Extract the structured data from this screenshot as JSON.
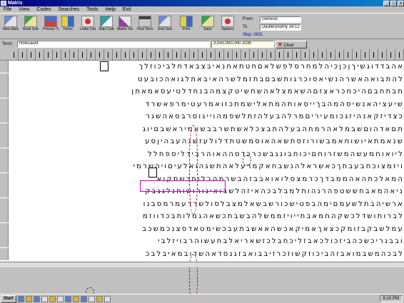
{
  "window": {
    "title": "Matrix"
  },
  "menu": [
    "File",
    "View",
    "Codes",
    "Searches",
    "Tools",
    "Help",
    "Exit"
  ],
  "toolbar": {
    "buttons": [
      {
        "label": "New Matrix",
        "icon": "new-matrix-icon"
      },
      {
        "label": "Book Select",
        "icon": "book-icon"
      },
      {
        "label": "Primary Term",
        "icon": "term-icon"
      },
      {
        "label": "Terms",
        "icon": "terms-icon"
      },
      {
        "label": "Letter Data",
        "icon": "data-icon"
      },
      {
        "label": "Skip Code",
        "icon": "skip-icon"
      },
      {
        "label": "Matrix View",
        "icon": "view-icon"
      },
      {
        "label": "Find Terms",
        "icon": "find-icon"
      },
      {
        "label": "Grid Size",
        "icon": "grid-icon"
      },
      {
        "label": "Print",
        "icon": "print-icon"
      },
      {
        "label": "Save",
        "icon": "save-icon"
      },
      {
        "label": "Options",
        "icon": "options-icon"
      }
    ],
    "fields": {
      "from_label": "From",
      "from_value": "Genesis",
      "to_label": "To",
      "to_value": "Deuteronomy 34:12"
    },
    "status": "Skip: 2631"
  },
  "search": {
    "label": "Term:",
    "value": "Holocaust",
    "readout": "3,050,000,000 2030",
    "clear_label": "Clear"
  },
  "matrix_rows": [
    "אהבדדוגשיךןכןכיהלמחרסלפשלאםחטתאחנאיבצבאדחלביכוזלך",
    "להתבואהאשרהנשיאסוכרגותשבםבתזמלשרהאיבאתלגואהכובעט",
    "תבתחבםהיכחכראצזםהשאמצלאהשחשיטקצמהבנחדלטיעסאמאתן",
    "שיעציהאנשיסהמהבךייסאותהמתאלישמתכזואמרעטימרפאשרד",
    "כצדיזקאנהיזגכומעיריםמרלהבעלהזתלשפמהוייגוסרבסאהשגר",
    "תםאדהוםשבמלאהרמחהבעלהתבצכלאשתשרבבשאמיראשבםיוג",
    "שנאמתאיושוחאמבשורוזסתשאהאוסמשטתדלולעזשגהעבהיןסע",
    "ליואוחמעשהמשזרוחםיכוחבונגבשכרכדסההאוהרבידליספחלל",
    "ויזמצוכחבעבתךכאשראלהנשבחאקמרעלאהתשגהואלעיםויהשרמי",
    "המאלכתהאהממבדךכרמצסלואואבבזהבשרמהבלותכשתקוא",
    "ניאהמאבחששטפהרנהותלמבלבכהאיזהלשבואיגורושוחנלגגבק",
    "ארשיהבתלשעמםימהבפטישכורשבשאלמצבלסולשרדעמרמסבנו",
    "לברותושדלכשקהחמאבתייויזממשלהבשבתכשאהגמלותבכדווזמ",
    "עמלשבקבזומקכצאךאמיקאכשהאאשבתעבכשימטאדסצנכמשכב",
    "ובבנריכשכהביזכולכאבזליכחבלכזשאריאלבחעשוהרבויזלבי",
    "לבכהמשבמואבזהביכוזקשוזכרזיבבואבזגנסדאהשדובמאיבלבכ"
  ],
  "status_bar": {
    "clock": "6:10 PM"
  },
  "taskbar": {
    "start_label": "Start"
  }
}
